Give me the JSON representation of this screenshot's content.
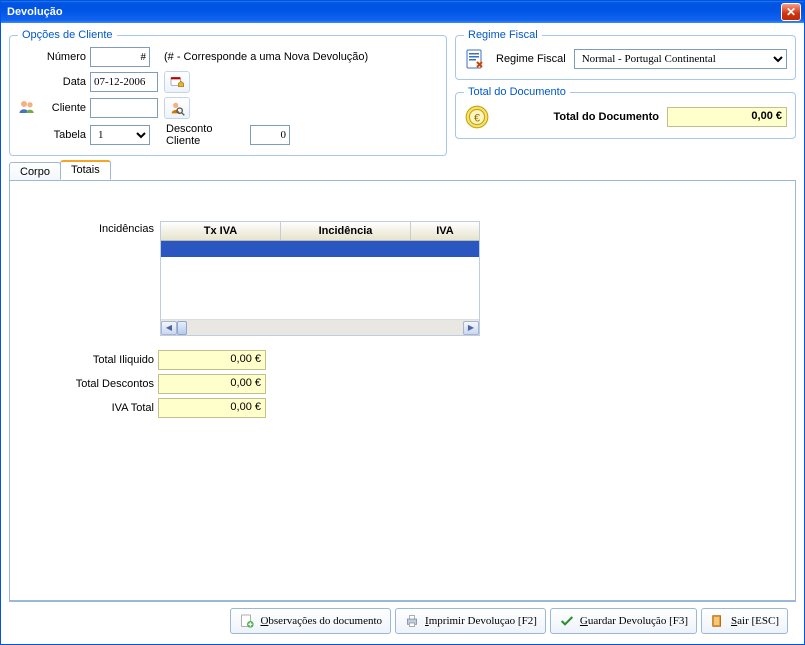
{
  "window": {
    "title": "Devolução"
  },
  "client_opts": {
    "legend": "Opções de Cliente",
    "numero_label": "Número",
    "numero_value": "#",
    "numero_hint": "(# - Corresponde a uma Nova Devolução)",
    "data_label": "Data",
    "data_value": "07-12-2006",
    "cliente_label": "Cliente",
    "cliente_value": "",
    "tabela_label": "Tabela",
    "tabela_value": "1",
    "desconto_label": "Desconto Cliente",
    "desconto_value": "0"
  },
  "fiscal": {
    "legend": "Regime Fiscal",
    "label": "Regime Fiscal",
    "value": "Normal - Portugal Continental"
  },
  "total_doc": {
    "legend": "Total do Documento",
    "label": "Total do Documento",
    "value": "0,00 €"
  },
  "tabs": {
    "corpo": "Corpo",
    "totais": "Totais"
  },
  "incidencias": {
    "label": "Incidências",
    "col_tx": "Tx IVA",
    "col_inc": "Incidência",
    "col_iva": "IVA"
  },
  "totals": {
    "iliquido_label": "Total Iliquido",
    "iliquido_value": "0,00 €",
    "descontos_label": "Total Descontos",
    "descontos_value": "0,00 €",
    "iva_label": "IVA Total",
    "iva_value": "0,00 €"
  },
  "footer": {
    "obs": "Observações do documento",
    "imprimir_pre": "Imprimir Devoluçao [F2]",
    "guardar_pre": "Guardar Devolução [F3]",
    "sair_pre": "Sair [ESC]"
  }
}
